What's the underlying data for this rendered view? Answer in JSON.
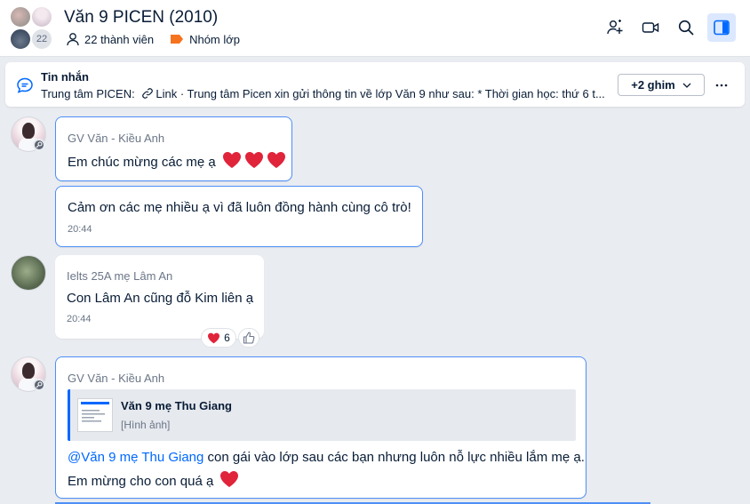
{
  "header": {
    "title": "Văn 9 PICEN (2010)",
    "avatar_count": "22",
    "members": "22 thành viên",
    "group_type": "Nhóm lớp"
  },
  "pinned": {
    "heading": "Tin nhắn",
    "sender": "Trung tâm PICEN:",
    "link_label": "Link",
    "preview": "· Trung tâm Picen xin gửi thông tin về lớp Văn 9 như sau:  * Thời gian học: thứ 6 t...",
    "more_label": "+2 ghim"
  },
  "messages": [
    {
      "sender": "GV Văn - Kiều Anh",
      "text": "Em chúc mừng các mẹ ạ"
    },
    {
      "text": "Cảm ơn các mẹ nhiều ạ vì đã luôn đồng hành cùng cô trò!",
      "time": "20:44"
    },
    {
      "sender": "Ielts 25A mẹ Lâm An",
      "text": "Con Lâm An cũng đỗ Kim liên ạ",
      "time": "20:44",
      "reaction_count": "6"
    },
    {
      "sender": "GV Văn - Kiều Anh",
      "quote_title": "Văn 9 mẹ Thu Giang",
      "quote_sub": "[Hình ảnh]",
      "mention": "@Văn 9 mẹ Thu Giang",
      "text_rest": " con gái vào lớp sau các bạn nhưng luôn nỗ lực nhiều lắm mẹ ạ.",
      "text_line2": "Em mừng cho con quá ạ"
    }
  ],
  "colors": {
    "accent": "#0068ff",
    "highlight_border": "#4f8ff7",
    "group_tag": "#f5731f",
    "heart": "#e0243a"
  }
}
